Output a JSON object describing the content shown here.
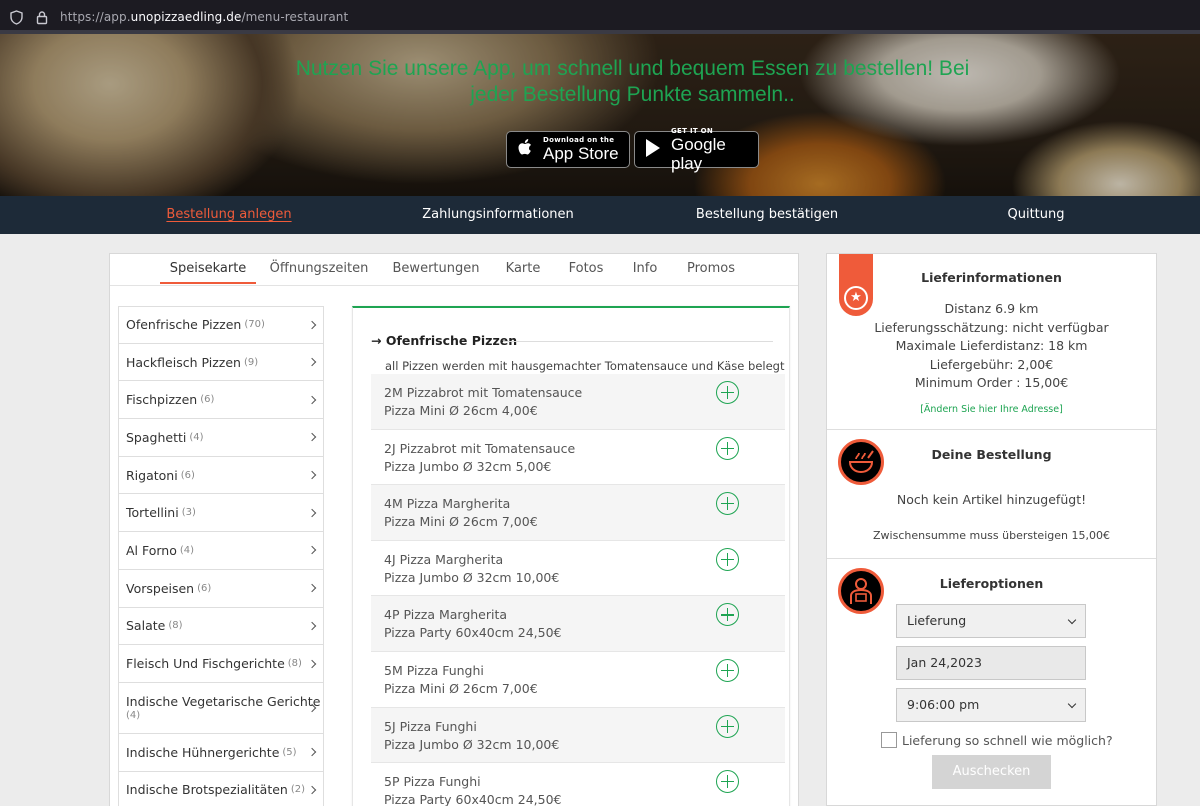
{
  "browser": {
    "url_prefix": "https://app.",
    "url_host": "unopizzaedling.de",
    "url_path": "/menu-restaurant"
  },
  "hero": {
    "line1": "Nutzen Sie unsere App, um schnell und bequem Essen zu bestellen! Bei",
    "line2": "jeder Bestellung Punkte sammeln..",
    "appstore_small": "Download on the",
    "appstore_big": "App Store",
    "googleplay_small": "GET IT ON",
    "googleplay_big": "Google play"
  },
  "steps": [
    {
      "label": "Bestellung anlegen",
      "active": true
    },
    {
      "label": "Zahlungsinformationen",
      "active": false
    },
    {
      "label": "Bestellung bestätigen",
      "active": false
    },
    {
      "label": "Quittung",
      "active": false
    }
  ],
  "tabs": [
    "Speisekarte",
    "Öffnungszeiten",
    "Bewertungen",
    "Karte",
    "Fotos",
    "Info",
    "Promos"
  ],
  "categories": [
    {
      "name": "Ofenfrische Pizzen",
      "count": "(70)"
    },
    {
      "name": "Hackfleisch Pizzen",
      "count": "(9)"
    },
    {
      "name": "Fischpizzen",
      "count": "(6)"
    },
    {
      "name": "Spaghetti",
      "count": "(4)"
    },
    {
      "name": "Rigatoni",
      "count": "(6)"
    },
    {
      "name": "Tortellini",
      "count": "(3)"
    },
    {
      "name": "Al Forno",
      "count": "(4)"
    },
    {
      "name": "Vorspeisen",
      "count": "(6)"
    },
    {
      "name": "Salate",
      "count": "(8)"
    },
    {
      "name": "Fleisch Und Fischgerichte",
      "count": "(8)"
    },
    {
      "name": "Indische Vegetarische Gerichte",
      "count": "(4)"
    },
    {
      "name": "Indische Hühnergerichte",
      "count": "(5)"
    },
    {
      "name": "Indische Brotspezialitäten",
      "count": "(2)"
    }
  ],
  "menu": {
    "heading": "Ofenfrische Pizzen",
    "description": "all Pizzen werden mit hausgemachter Tomatensauce und Käse belegt",
    "items": [
      {
        "name": "2M Pizzabrot mit Tomatensauce",
        "sub": "Pizza Mini Ø 26cm 4,00€"
      },
      {
        "name": "2J Pizzabrot mit Tomatensauce",
        "sub": "Pizza Jumbo Ø 32cm 5,00€"
      },
      {
        "name": "4M Pizza Margherita",
        "sub": "Pizza Mini Ø 26cm 7,00€"
      },
      {
        "name": "4J Pizza Margherita",
        "sub": "Pizza Jumbo Ø 32cm 10,00€"
      },
      {
        "name": "4P Pizza Margherita",
        "sub": "Pizza Party 60x40cm 24,50€"
      },
      {
        "name": "5M Pizza Funghi",
        "sub": "Pizza Mini Ø 26cm 7,00€"
      },
      {
        "name": "5J Pizza Funghi",
        "sub": "Pizza Jumbo Ø 32cm 10,00€"
      },
      {
        "name": "5P Pizza Funghi",
        "sub": "Pizza Party 60x40cm 24,50€"
      }
    ]
  },
  "delivery_info": {
    "title": "Lieferinformationen",
    "lines": [
      "Distanz 6.9 km",
      "Lieferungsschätzung: nicht verfügbar",
      "Maximale Lieferdistanz: 18 km",
      "Liefergebühr: 2,00€",
      "Minimum Order : 15,00€"
    ],
    "change_address": "[Ändern Sie hier Ihre Adresse]"
  },
  "order": {
    "title": "Deine Bestellung",
    "empty": "Noch kein Artikel hinzugefügt!",
    "min_note": "Zwischensumme muss übersteigen 15,00€"
  },
  "delivery_options": {
    "title": "Lieferoptionen",
    "mode": "Lieferung",
    "date": "Jan 24,2023",
    "time": "9:06:00 pm",
    "asap_label": "Lieferung so schnell wie möglich?",
    "button": "Auschecken"
  },
  "colors": {
    "accent": "#ef5b3a",
    "green": "#1ea452",
    "navy": "#1d2a38"
  }
}
